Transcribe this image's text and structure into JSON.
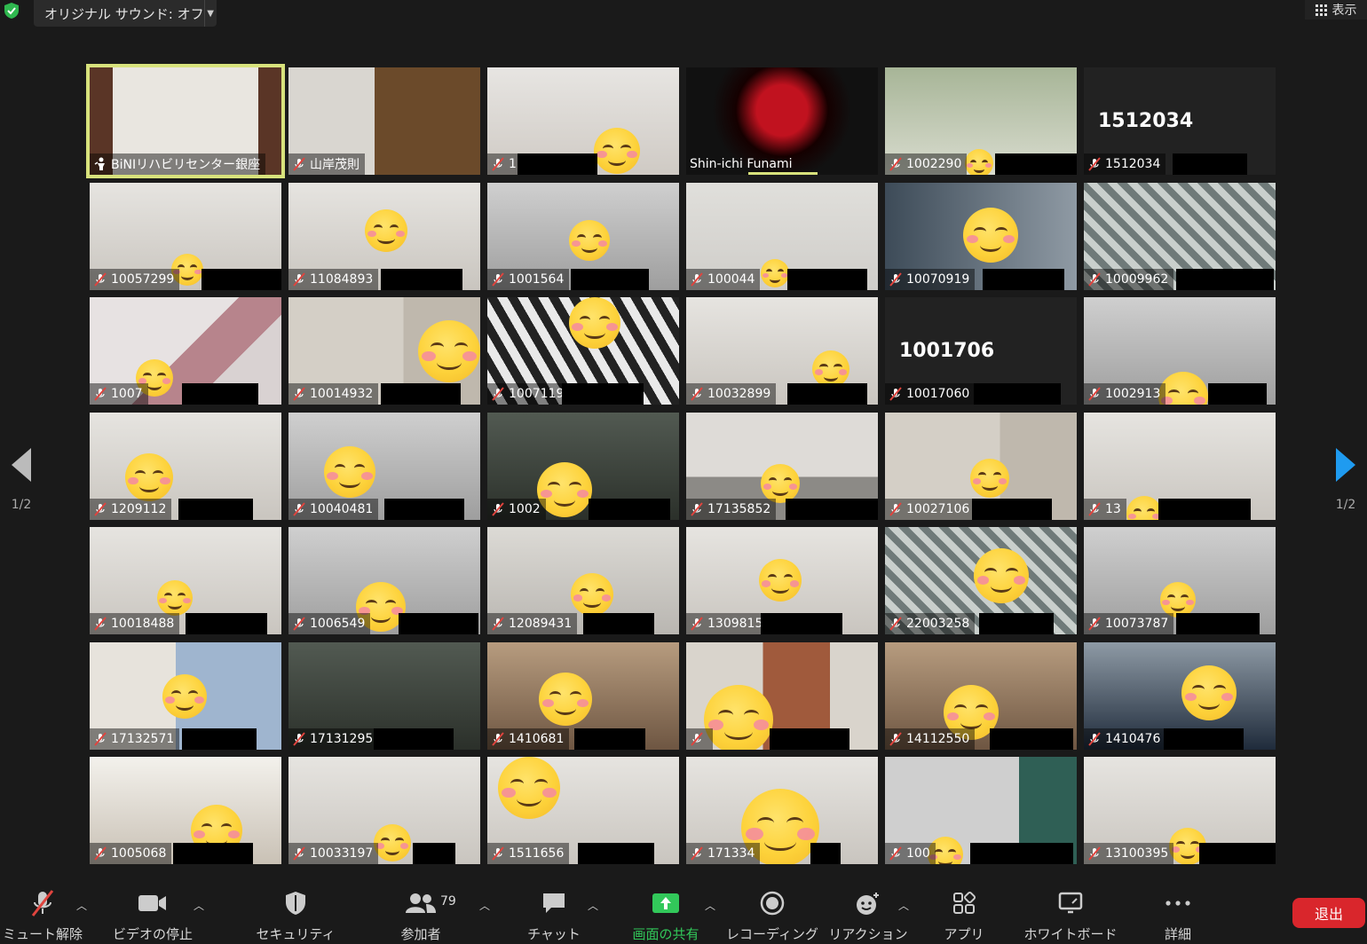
{
  "top_bar": {
    "security_icon": "shield-check-icon",
    "original_sound_label": "オリジナル サウンド: オフ",
    "view_label": "表示"
  },
  "pager": {
    "left_label": "1/2",
    "right_label": "1/2"
  },
  "tiles": [
    {
      "name": "BiNIリハビリセンター銀座",
      "pin": true,
      "active": true,
      "scene": "room-curtain"
    },
    {
      "name": "山岸茂則",
      "scene": "bookshelf"
    },
    {
      "name": "1",
      "scene": "shelf-white",
      "emoji": true
    },
    {
      "name": "Shin-ichi Funami",
      "scene": "logo-red",
      "speaking": true
    },
    {
      "name": "1002290",
      "scene": "curtain-green",
      "emoji": true
    },
    {
      "name": "1512034",
      "scene": "black",
      "big_id": "1512034"
    },
    {
      "name": "10057299",
      "scene": "room-light",
      "emoji": true
    },
    {
      "name": "11084893",
      "scene": "room-light",
      "emoji": true
    },
    {
      "name": "1001564",
      "scene": "room-grey",
      "emoji": true
    },
    {
      "name": "100044",
      "scene": "chart",
      "emoji": true
    },
    {
      "name": "10070919",
      "scene": "bookshelf-blur",
      "emoji": true
    },
    {
      "name": "10009962",
      "scene": "curtain-pattern"
    },
    {
      "name": "1007",
      "scene": "room-pink",
      "emoji": true
    },
    {
      "name": "10014932",
      "scene": "room-cabinet",
      "emoji": true
    },
    {
      "name": "1007119",
      "scene": "room-zebra",
      "emoji": true
    },
    {
      "name": "10032899",
      "scene": "room-light",
      "emoji": true
    },
    {
      "name": "10017060",
      "scene": "black",
      "big_id": "1001706"
    },
    {
      "name": "1002913",
      "scene": "room-grey",
      "emoji": true
    },
    {
      "name": "1209112",
      "scene": "room-light",
      "emoji": true
    },
    {
      "name": "10040481",
      "scene": "room-grey",
      "emoji": true
    },
    {
      "name": "1002",
      "scene": "room-dark",
      "emoji": true
    },
    {
      "name": "17135852",
      "scene": "room-sofa",
      "emoji": true
    },
    {
      "name": "10027106",
      "scene": "room-cabinet",
      "emoji": true
    },
    {
      "name": "13",
      "scene": "room-light",
      "emoji": true
    },
    {
      "name": "10018488",
      "scene": "room-light",
      "emoji": true
    },
    {
      "name": "1006549",
      "scene": "room-grey",
      "emoji": true
    },
    {
      "name": "12089431",
      "scene": "room-wall",
      "emoji": true
    },
    {
      "name": "1309815",
      "scene": "room-light",
      "emoji": true
    },
    {
      "name": "22003258",
      "scene": "curtain-pattern",
      "emoji": true
    },
    {
      "name": "10073787",
      "scene": "room-grey",
      "emoji": true
    },
    {
      "name": "17132571",
      "scene": "room-blue-curtain",
      "emoji": true
    },
    {
      "name": "17131295",
      "scene": "room-dark"
    },
    {
      "name": "1410681",
      "scene": "room-warm",
      "emoji": true
    },
    {
      "name": "",
      "scene": "room-brick",
      "emoji": true
    },
    {
      "name": "14112550",
      "scene": "room-warm",
      "emoji": true
    },
    {
      "name": "1410476",
      "scene": "room-dark-blue",
      "emoji": true
    },
    {
      "name": "1005068",
      "scene": "room-window",
      "emoji": true
    },
    {
      "name": "10033197",
      "scene": "room-light",
      "emoji": true
    },
    {
      "name": "1511656",
      "scene": "room-light",
      "emoji": true
    },
    {
      "name": "171334",
      "scene": "room-light",
      "emoji": true
    },
    {
      "name": "100",
      "scene": "room-green-curtain",
      "emoji": true
    },
    {
      "name": "13100395",
      "scene": "room-light",
      "emoji": true
    }
  ],
  "toolbar": {
    "unmute": "ミュート解除",
    "stop_video": "ビデオの停止",
    "security": "セキュリティ",
    "participants": "参加者",
    "participants_count": "79",
    "chat": "チャット",
    "share_screen": "画面の共有",
    "recording": "レコーディング",
    "reactions": "リアクション",
    "apps": "アプリ",
    "whiteboard": "ホワイトボード",
    "more": "詳細",
    "leave": "退出"
  },
  "colors": {
    "background": "#1a1a1a",
    "active_outline": "#d8e27c",
    "share_green": "#32c85a",
    "leave_red": "#d9262c",
    "mute_red": "#e0443e",
    "pager_blue": "#1f9bf0"
  }
}
